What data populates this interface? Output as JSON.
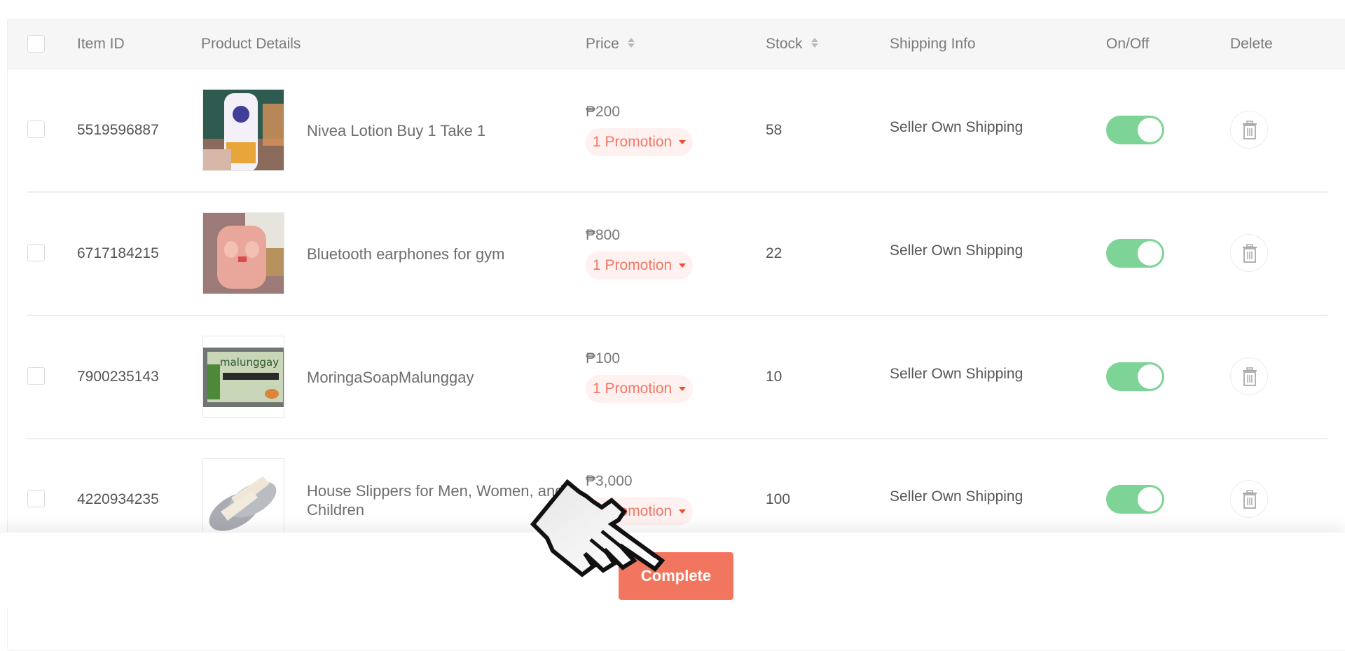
{
  "table": {
    "headers": {
      "item_id": "Item ID",
      "product_details": "Product Details",
      "price": "Price",
      "stock": "Stock",
      "shipping_info": "Shipping Info",
      "on_off": "On/Off",
      "delete": "Delete"
    },
    "rows": [
      {
        "item_id": "5519596887",
        "name": "Nivea Lotion Buy 1 Take 1",
        "price": "₱200",
        "promotion": "1 Promotion",
        "stock": "58",
        "shipping": "Seller Own Shipping",
        "enabled": true,
        "thumb": "nivea-lotion-photo"
      },
      {
        "item_id": "6717184215",
        "name": "Bluetooth earphones for gym",
        "price": "₱800",
        "promotion": "1 Promotion",
        "stock": "22",
        "shipping": "Seller Own Shipping",
        "enabled": true,
        "thumb": "pink-earbuds-photo"
      },
      {
        "item_id": "7900235143",
        "name": "MoringaSoapMalunggay",
        "price": "₱100",
        "promotion": "1 Promotion",
        "stock": "10",
        "shipping": "Seller Own Shipping",
        "enabled": true,
        "thumb": "malunggay-soap-photo"
      },
      {
        "item_id": "4220934235",
        "name": "House Slippers for Men, Women, and Children",
        "price": "₱3,000",
        "promotion": "1 Promotion",
        "stock": "100",
        "shipping": "Seller Own Shipping",
        "enabled": true,
        "thumb": "grey-slippers-photo"
      }
    ]
  },
  "footer": {
    "complete_label": "Complete"
  },
  "colors": {
    "accent": "#f2765f",
    "toggle_on": "#7dd496",
    "promo_text": "#f07868",
    "promo_bg": "#fff1ef"
  }
}
